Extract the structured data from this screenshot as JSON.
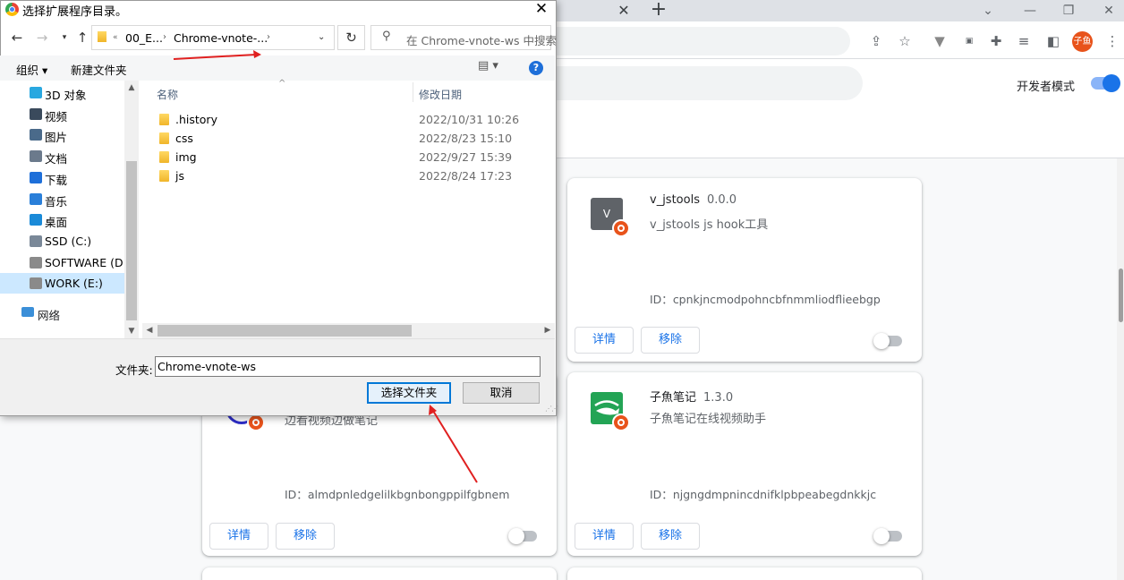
{
  "browser": {
    "avatar_text": "子鱼",
    "toolbar_icons": [
      "share-icon",
      "star-icon",
      "vue-devtools-icon",
      "rp-icon",
      "puzzle-icon",
      "reading-list-icon",
      "side-panel-icon",
      "menu-icon"
    ]
  },
  "extensions_page": {
    "dev_mode_label": "开发者模式",
    "cards": [
      {
        "name": "v_jstools",
        "version": "0.0.0",
        "description": "v_jstools js hook工具",
        "id_label": "ID：",
        "id_value": "cpnkjncmodpohncbfnmmliodflieebgp",
        "icon_letter": "V",
        "details_label": "详情",
        "remove_label": "移除"
      },
      {
        "name": "",
        "version": "",
        "description": "边看视频边做笔记",
        "id_label": "ID：",
        "id_value": "almdpnledgelilkbgnbongppilfgbnem",
        "details_label": "详情",
        "remove_label": "移除"
      },
      {
        "name": "子魚笔记",
        "version": "1.3.0",
        "description": "子魚笔记在线视频助手",
        "id_label": "ID：",
        "id_value": "njgngdmpnincdnifklpbpeabegdnkkjc",
        "details_label": "详情",
        "remove_label": "移除"
      }
    ]
  },
  "dialog": {
    "title": "选择扩展程序目录。",
    "close_label": "✕",
    "breadcrumb": [
      "00_E...",
      "Chrome-vnote-..."
    ],
    "search_placeholder": "在 Chrome-vnote-ws 中搜索",
    "commands": {
      "organize": "组织",
      "new_folder": "新建文件夹"
    },
    "nav_items": [
      {
        "label": "3D 对象",
        "icon": "3d-objects-icon",
        "color": "#29a8e0"
      },
      {
        "label": "视频",
        "icon": "videos-icon",
        "color": "#3a4a5c"
      },
      {
        "label": "图片",
        "icon": "pictures-icon",
        "color": "#4a6a8a"
      },
      {
        "label": "文档",
        "icon": "documents-icon",
        "color": "#6b7a8c"
      },
      {
        "label": "下载",
        "icon": "downloads-icon",
        "color": "#1e6fd9"
      },
      {
        "label": "音乐",
        "icon": "music-icon",
        "color": "#2a7fd9"
      },
      {
        "label": "桌面",
        "icon": "desktop-icon",
        "color": "#1a8ad8"
      },
      {
        "label": "SSD (C:)",
        "icon": "drive-icon",
        "color": "#7a8898"
      },
      {
        "label": "SOFTWARE (D:)",
        "icon": "drive-icon",
        "color": "#8a8a8a"
      },
      {
        "label": "WORK (E:)",
        "icon": "drive-icon",
        "color": "#8a8a8a"
      }
    ],
    "network_label": "网络",
    "columns": {
      "name": "名称",
      "modified": "修改日期"
    },
    "files": [
      {
        "name": ".history",
        "modified": "2022/10/31 10:26"
      },
      {
        "name": "css",
        "modified": "2022/8/23 15:10"
      },
      {
        "name": "img",
        "modified": "2022/9/27 15:39"
      },
      {
        "name": "js",
        "modified": "2022/8/24 17:23"
      }
    ],
    "folder_field_label": "文件夹:",
    "folder_field_value": "Chrome-vnote-ws",
    "select_button": "选择文件夹",
    "cancel_button": "取消"
  },
  "colors": {
    "accent": "#1a73e8",
    "badge": "#e8531b",
    "annotation": "#e02020",
    "selection": "#cce8ff"
  }
}
